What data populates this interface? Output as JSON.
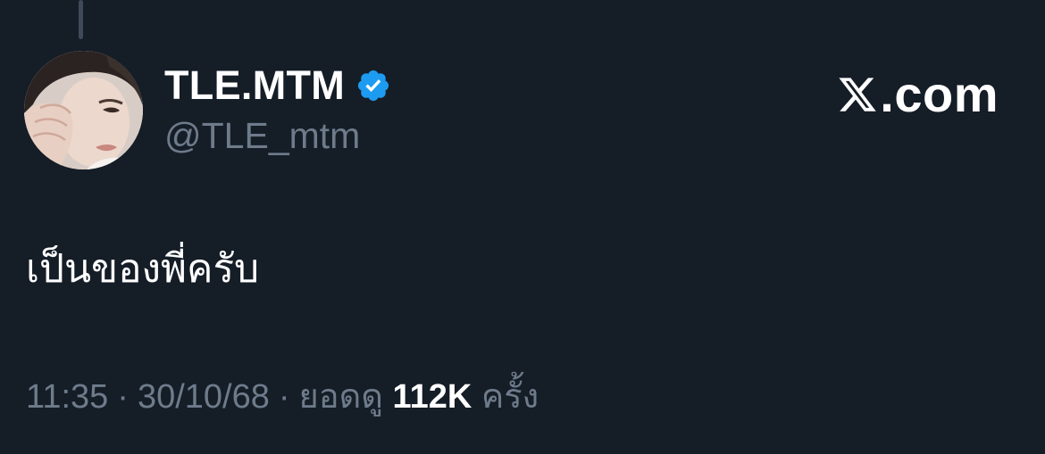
{
  "post": {
    "author": {
      "display_name": "TLE.MTM",
      "handle": "@TLE_mtm",
      "verified": true,
      "verified_color": "#1d9bf0"
    },
    "brand": {
      "text": ".com",
      "logo_icon": "x-logo-icon"
    },
    "text": "เป็นของพี่ครับ",
    "meta": {
      "time": "11:35",
      "date": "30/10/68",
      "separator": "·",
      "views_prefix": "ยอดดู",
      "views_count": "112K",
      "views_suffix": "ครั้ง"
    }
  },
  "colors": {
    "background": "#151d27",
    "primary_text": "#ffffff",
    "secondary_text": "#6e7b8b",
    "thread_line": "#3e4a58"
  }
}
